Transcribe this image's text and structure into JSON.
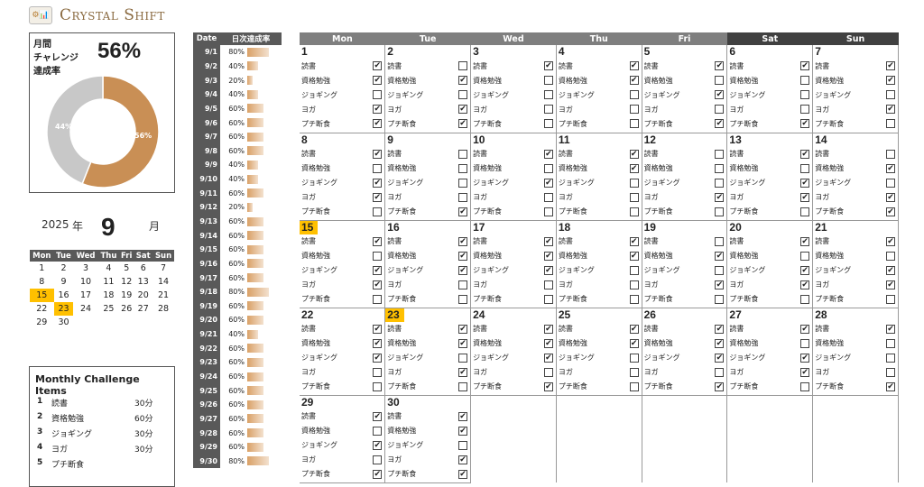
{
  "app": {
    "logo_icon": "⚙📊",
    "title": "Crystal Shift"
  },
  "rate": {
    "label1": "月間",
    "label2": "チャレンジ",
    "label3": "達成率",
    "value": "56%",
    "achieved": 56,
    "remaining": 44,
    "achieved_label": "56%",
    "remaining_label": "44%",
    "achieved_color": "#c98f55",
    "remaining_color": "#c8c8c8"
  },
  "calendar_header": {
    "year": "2025",
    "year_label": "年",
    "month": "9",
    "month_label": "月"
  },
  "mini_calendar": {
    "headers": [
      "Mon",
      "Tue",
      "Wed",
      "Thu",
      "Fri",
      "Sat",
      "Sun"
    ],
    "weeks": [
      [
        "1",
        "2",
        "3",
        "4",
        "5",
        "6",
        "7"
      ],
      [
        "8",
        "9",
        "10",
        "11",
        "12",
        "13",
        "14"
      ],
      [
        "15",
        "16",
        "17",
        "18",
        "19",
        "20",
        "21"
      ],
      [
        "22",
        "23",
        "24",
        "25",
        "26",
        "27",
        "28"
      ],
      [
        "29",
        "30",
        "",
        "",
        "",
        "",
        ""
      ]
    ],
    "highlighted": [
      "15",
      "23"
    ]
  },
  "challenge_items": {
    "title": "Monthly Challenge Items",
    "items": [
      {
        "num": "1",
        "label": "読書",
        "time": "30分"
      },
      {
        "num": "2",
        "label": "資格勉強",
        "time": "60分"
      },
      {
        "num": "3",
        "label": "ジョギング",
        "time": "30分"
      },
      {
        "num": "4",
        "label": "ヨガ",
        "time": "30分"
      },
      {
        "num": "5",
        "label": "プチ断食",
        "time": ""
      }
    ]
  },
  "daily_rates": {
    "header_date": "Date",
    "header_rate": "日次達成率",
    "rows": [
      {
        "date": "9/1",
        "pct": "80%",
        "v": 80
      },
      {
        "date": "9/2",
        "pct": "40%",
        "v": 40
      },
      {
        "date": "9/3",
        "pct": "20%",
        "v": 20
      },
      {
        "date": "9/4",
        "pct": "40%",
        "v": 40
      },
      {
        "date": "9/5",
        "pct": "60%",
        "v": 60
      },
      {
        "date": "9/6",
        "pct": "60%",
        "v": 60
      },
      {
        "date": "9/7",
        "pct": "60%",
        "v": 60
      },
      {
        "date": "9/8",
        "pct": "60%",
        "v": 60
      },
      {
        "date": "9/9",
        "pct": "40%",
        "v": 40
      },
      {
        "date": "9/10",
        "pct": "40%",
        "v": 40
      },
      {
        "date": "9/11",
        "pct": "60%",
        "v": 60
      },
      {
        "date": "9/12",
        "pct": "20%",
        "v": 20
      },
      {
        "date": "9/13",
        "pct": "60%",
        "v": 60
      },
      {
        "date": "9/14",
        "pct": "60%",
        "v": 60
      },
      {
        "date": "9/15",
        "pct": "60%",
        "v": 60
      },
      {
        "date": "9/16",
        "pct": "60%",
        "v": 60
      },
      {
        "date": "9/17",
        "pct": "60%",
        "v": 60
      },
      {
        "date": "9/18",
        "pct": "80%",
        "v": 80
      },
      {
        "date": "9/19",
        "pct": "60%",
        "v": 60
      },
      {
        "date": "9/20",
        "pct": "60%",
        "v": 60
      },
      {
        "date": "9/21",
        "pct": "40%",
        "v": 40
      },
      {
        "date": "9/22",
        "pct": "60%",
        "v": 60
      },
      {
        "date": "9/23",
        "pct": "60%",
        "v": 60
      },
      {
        "date": "9/24",
        "pct": "60%",
        "v": 60
      },
      {
        "date": "9/25",
        "pct": "60%",
        "v": 60
      },
      {
        "date": "9/26",
        "pct": "60%",
        "v": 60
      },
      {
        "date": "9/27",
        "pct": "60%",
        "v": 60
      },
      {
        "date": "9/28",
        "pct": "60%",
        "v": 60
      },
      {
        "date": "9/29",
        "pct": "60%",
        "v": 60
      },
      {
        "date": "9/30",
        "pct": "80%",
        "v": 80
      }
    ]
  },
  "main_calendar": {
    "days_of_week": [
      "Mon",
      "Tue",
      "Wed",
      "Thu",
      "Fri",
      "Sat",
      "Sun"
    ],
    "task_labels": [
      "読書",
      "資格勉強",
      "ジョギング",
      "ヨガ",
      "プチ断食"
    ],
    "check_mark": "✔",
    "highlighted": [
      "15",
      "23"
    ],
    "days": [
      {
        "d": "1",
        "c": [
          1,
          1,
          0,
          1,
          1
        ]
      },
      {
        "d": "2",
        "c": [
          0,
          1,
          0,
          1,
          1
        ]
      },
      {
        "d": "3",
        "c": [
          1,
          0,
          0,
          0,
          0
        ]
      },
      {
        "d": "4",
        "c": [
          1,
          1,
          0,
          0,
          0
        ]
      },
      {
        "d": "5",
        "c": [
          1,
          0,
          1,
          0,
          1
        ]
      },
      {
        "d": "6",
        "c": [
          1,
          0,
          0,
          0,
          1
        ]
      },
      {
        "d": "7",
        "c": [
          1,
          1,
          0,
          1,
          0
        ]
      },
      {
        "d": "8",
        "c": [
          1,
          0,
          1,
          1,
          0
        ]
      },
      {
        "d": "9",
        "c": [
          0,
          0,
          0,
          0,
          1
        ]
      },
      {
        "d": "10",
        "c": [
          1,
          0,
          1,
          0,
          0
        ]
      },
      {
        "d": "11",
        "c": [
          1,
          1,
          0,
          0,
          0
        ]
      },
      {
        "d": "12",
        "c": [
          0,
          0,
          0,
          1,
          0
        ]
      },
      {
        "d": "13",
        "c": [
          1,
          0,
          1,
          1,
          0
        ]
      },
      {
        "d": "14",
        "c": [
          0,
          1,
          0,
          1,
          1
        ]
      },
      {
        "d": "15",
        "c": [
          1,
          0,
          1,
          1,
          0
        ]
      },
      {
        "d": "16",
        "c": [
          1,
          1,
          1,
          0,
          0
        ]
      },
      {
        "d": "17",
        "c": [
          1,
          1,
          1,
          0,
          0
        ]
      },
      {
        "d": "18",
        "c": [
          1,
          1,
          0,
          0,
          0
        ]
      },
      {
        "d": "19",
        "c": [
          0,
          1,
          0,
          1,
          0
        ]
      },
      {
        "d": "20",
        "c": [
          1,
          0,
          1,
          1,
          0
        ]
      },
      {
        "d": "21",
        "c": [
          1,
          0,
          1,
          1,
          0
        ]
      },
      {
        "d": "22",
        "c": [
          1,
          1,
          1,
          0,
          0
        ]
      },
      {
        "d": "23",
        "c": [
          1,
          1,
          0,
          1,
          0
        ]
      },
      {
        "d": "24",
        "c": [
          1,
          1,
          1,
          0,
          1
        ]
      },
      {
        "d": "25",
        "c": [
          1,
          1,
          0,
          0,
          0
        ]
      },
      {
        "d": "26",
        "c": [
          1,
          1,
          1,
          0,
          1
        ]
      },
      {
        "d": "27",
        "c": [
          1,
          0,
          1,
          1,
          0
        ]
      },
      {
        "d": "28",
        "c": [
          1,
          0,
          0,
          0,
          1
        ]
      },
      {
        "d": "29",
        "c": [
          1,
          0,
          1,
          0,
          1
        ]
      },
      {
        "d": "30",
        "c": [
          1,
          1,
          0,
          1,
          1
        ]
      }
    ]
  }
}
